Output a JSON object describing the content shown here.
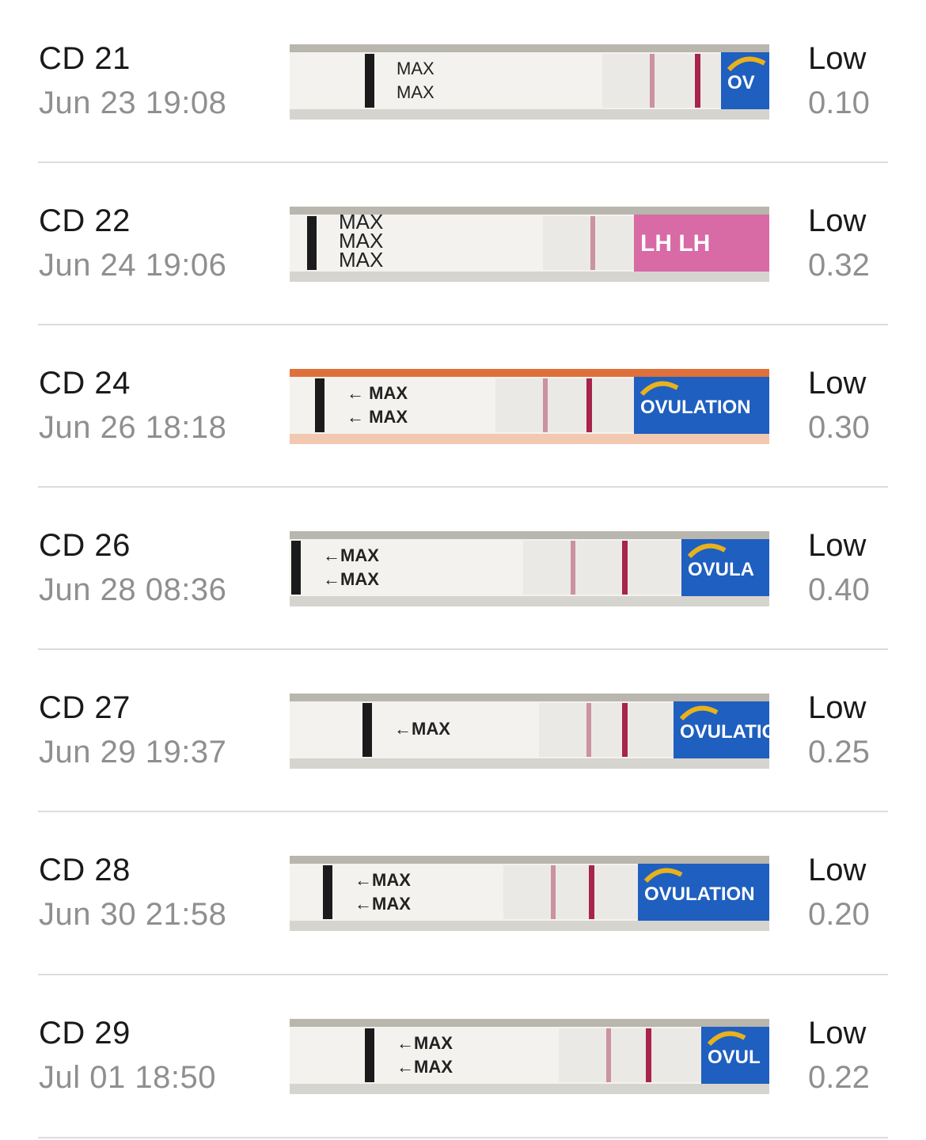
{
  "entries": [
    {
      "cycle_day": "CD 21",
      "datetime": "Jun 23 19:08",
      "level": "Low",
      "value": "0.10",
      "strip": {
        "brand_label": "OV",
        "max_texts": [
          "MAX",
          "MAX"
        ],
        "style": "blue"
      }
    },
    {
      "cycle_day": "CD 22",
      "datetime": "Jun 24 19:06",
      "level": "Low",
      "value": "0.32",
      "strip": {
        "brand_label": "LH LH",
        "max_texts": [
          "MAX",
          "MAX",
          "MAX"
        ],
        "style": "pink"
      }
    },
    {
      "cycle_day": "CD 24",
      "datetime": "Jun 26 18:18",
      "level": "Low",
      "value": "0.30",
      "strip": {
        "brand_label": "OVULATION",
        "max_texts": [
          "← MAX",
          "← MAX"
        ],
        "style": "blue"
      }
    },
    {
      "cycle_day": "CD 26",
      "datetime": "Jun 28 08:36",
      "level": "Low",
      "value": "0.40",
      "strip": {
        "brand_label": "OVULA",
        "max_texts": [
          "←MAX",
          "←MAX"
        ],
        "style": "blue"
      }
    },
    {
      "cycle_day": "CD 27",
      "datetime": "Jun 29 19:37",
      "level": "Low",
      "value": "0.25",
      "strip": {
        "brand_label": "OVULATIO",
        "max_texts": [
          "←MAX"
        ],
        "style": "blue"
      }
    },
    {
      "cycle_day": "CD 28",
      "datetime": "Jun 30 21:58",
      "level": "Low",
      "value": "0.20",
      "strip": {
        "brand_label": "OVULATION",
        "max_texts": [
          "←MAX",
          "←MAX"
        ],
        "style": "blue"
      }
    },
    {
      "cycle_day": "CD 29",
      "datetime": "Jul 01 18:50",
      "level": "Low",
      "value": "0.22",
      "strip": {
        "brand_label": "OVUL",
        "max_texts": [
          "←MAX",
          "←MAX"
        ],
        "style": "blue"
      }
    }
  ],
  "colors": {
    "control_line": "#a8244d",
    "test_line": "#b04a68",
    "brand_blue": "#1f5fbf",
    "brand_pink": "#d86aa6",
    "brand_yellow": "#e8b21c"
  }
}
